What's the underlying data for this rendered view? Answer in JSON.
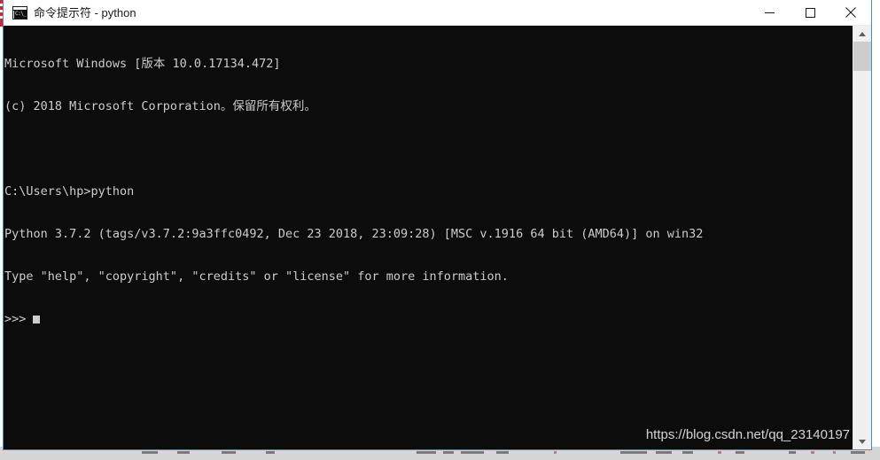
{
  "window": {
    "title": "命令提示符 - python",
    "icon": "cmd-console-icon",
    "border_color": "#3a8fd6",
    "titlebar_background": "#ffffff",
    "title_color": "#1b1b1b",
    "controls": {
      "minimize_label": "最小化",
      "maximize_label": "最大化",
      "close_label": "关闭"
    }
  },
  "console": {
    "background": "#0c0c0c",
    "foreground": "#cccccc",
    "lines": [
      "Microsoft Windows [版本 10.0.17134.472]",
      "(c) 2018 Microsoft Corporation。保留所有权利。",
      "",
      "C:\\Users\\hp>python",
      "Python 3.7.2 (tags/v3.7.2:9a3ffc0492, Dec 23 2018, 23:09:28) [MSC v.1916 64 bit (AMD64)] on win32",
      "Type \"help\", \"copyright\", \"credits\" or \"license\" for more information."
    ],
    "prompt": ">>>",
    "cursor": "block-cursor"
  },
  "watermark": {
    "text": "https://blog.csdn.net/qq_23140197"
  },
  "scrollbar": {
    "up_arrow": "scroll-up-arrow-icon",
    "down_arrow": "scroll-down-arrow-icon",
    "thumb": "scroll-thumb",
    "track_color": "#f0f0f0",
    "thumb_color": "#cdcdcd"
  }
}
